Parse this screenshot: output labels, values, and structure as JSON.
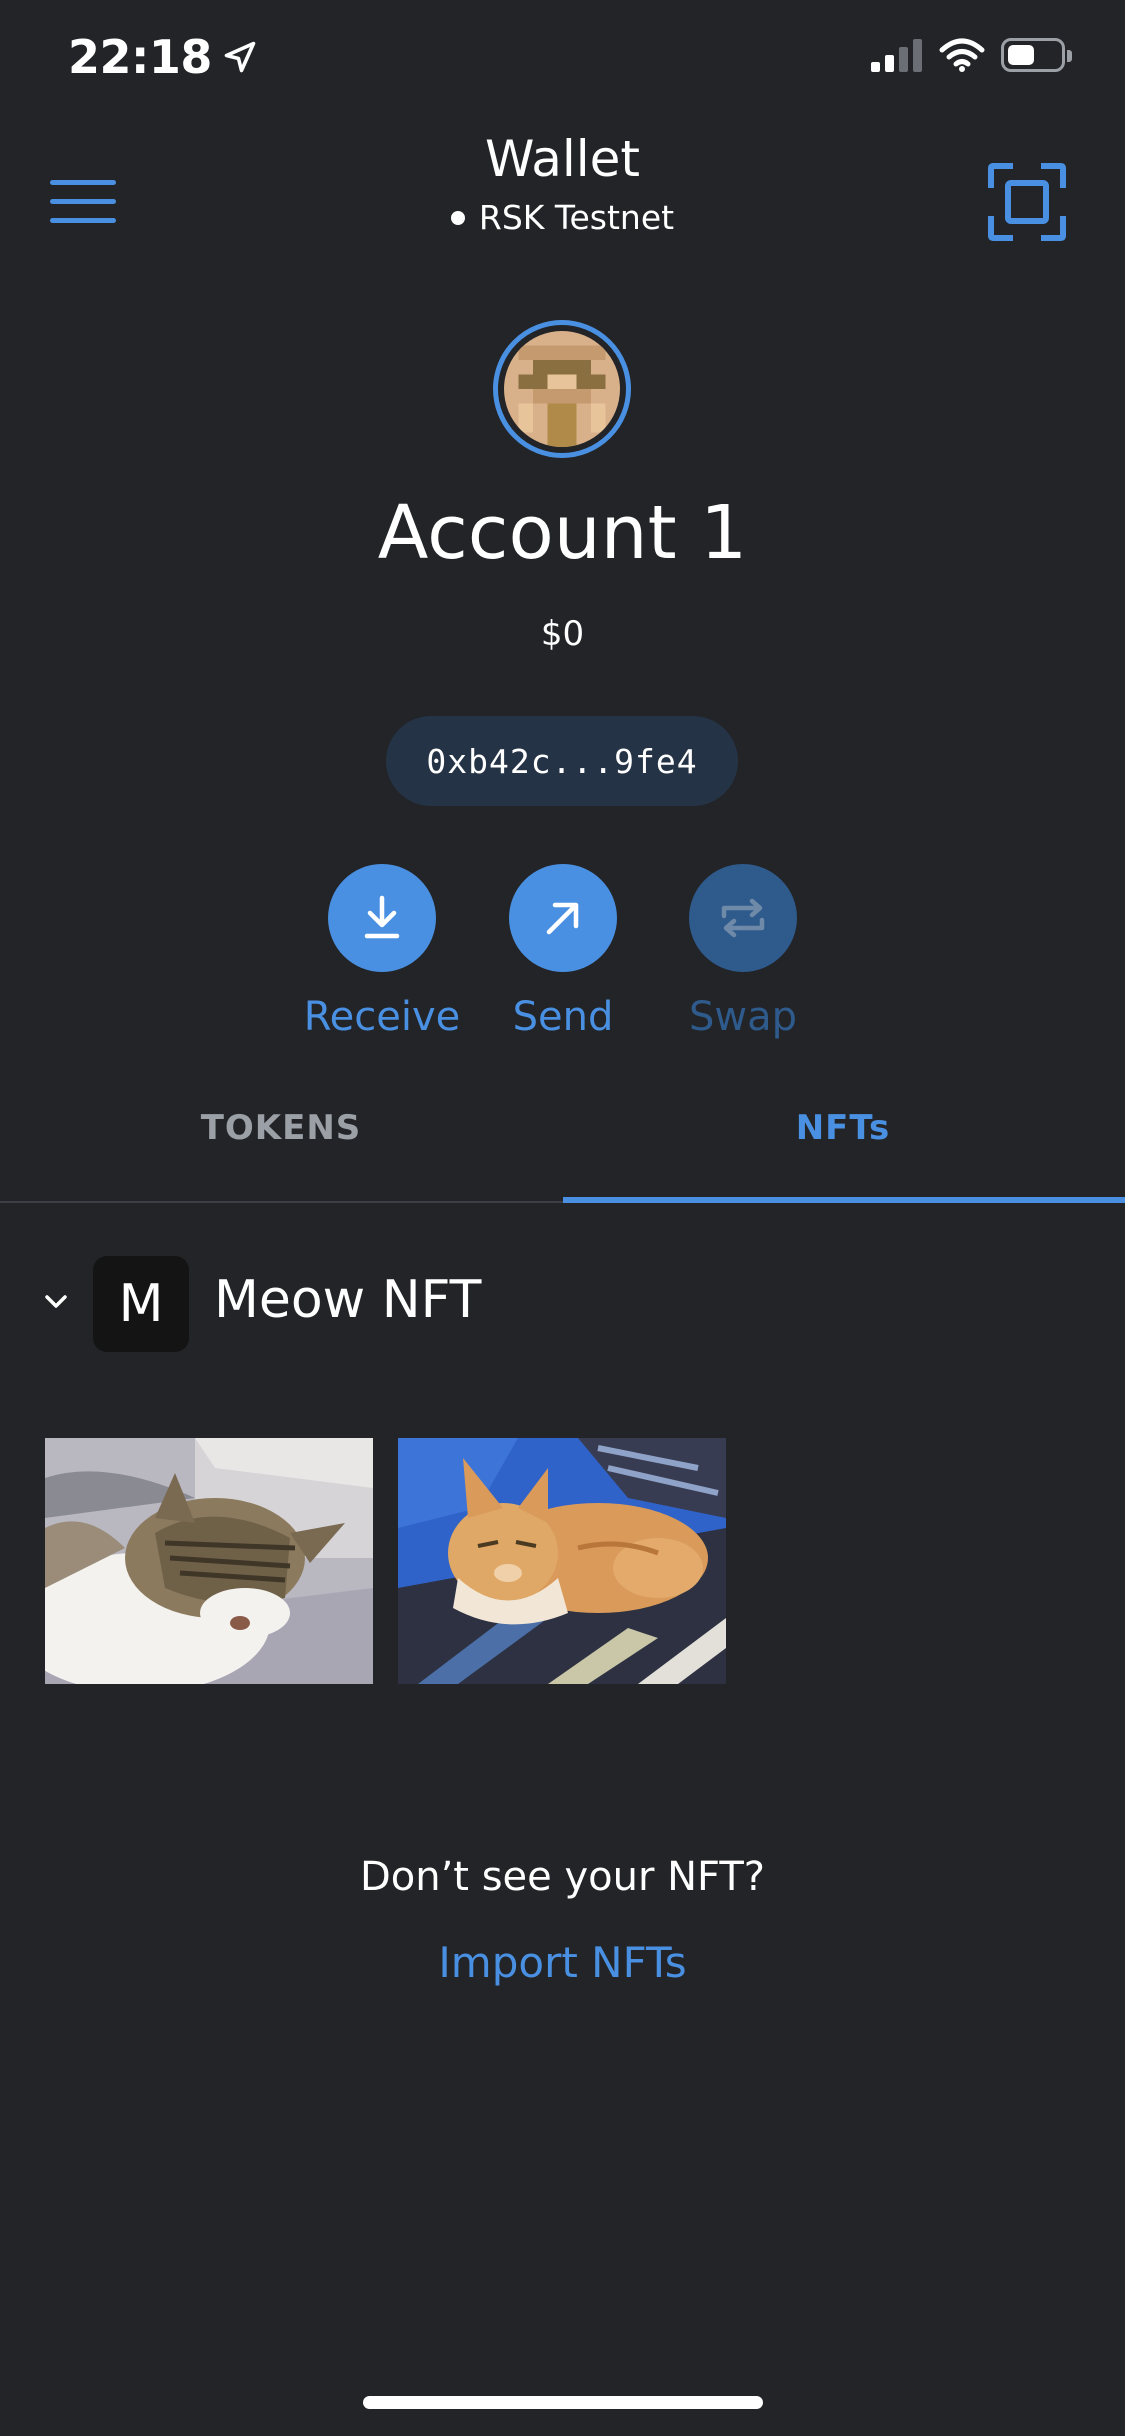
{
  "status_bar": {
    "time": "22:18",
    "icons": [
      "location-arrow-icon",
      "signal-icon",
      "wifi-icon",
      "battery-icon"
    ]
  },
  "header": {
    "title": "Wallet",
    "network": "RSK Testnet",
    "menu_icon": "hamburger-menu-icon",
    "scan_icon": "qr-scan-icon"
  },
  "account": {
    "name": "Account 1",
    "balance": "$0",
    "address": "0xb42c...9fe4"
  },
  "actions": [
    {
      "label": "Receive",
      "icon": "download-icon",
      "enabled": true
    },
    {
      "label": "Send",
      "icon": "arrow-up-right-icon",
      "enabled": true
    },
    {
      "label": "Swap",
      "icon": "swap-icon",
      "enabled": false
    }
  ],
  "tabs": [
    {
      "label": "TOKENS",
      "active": false
    },
    {
      "label": "NFTs",
      "active": true
    }
  ],
  "collection": {
    "logo_letter": "M",
    "name": "Meow NFT",
    "items": [
      {
        "image": "tabby-white-cat-sleeping"
      },
      {
        "image": "orange-cat-lying"
      }
    ]
  },
  "empty_state": {
    "text": "Don’t see your NFT?",
    "link": "Import NFTs"
  },
  "colors": {
    "background": "#222427",
    "accent": "#4a90e2",
    "accent_disabled": "#2e5a8c",
    "muted": "#9aa0a6",
    "pill": "#253346"
  }
}
